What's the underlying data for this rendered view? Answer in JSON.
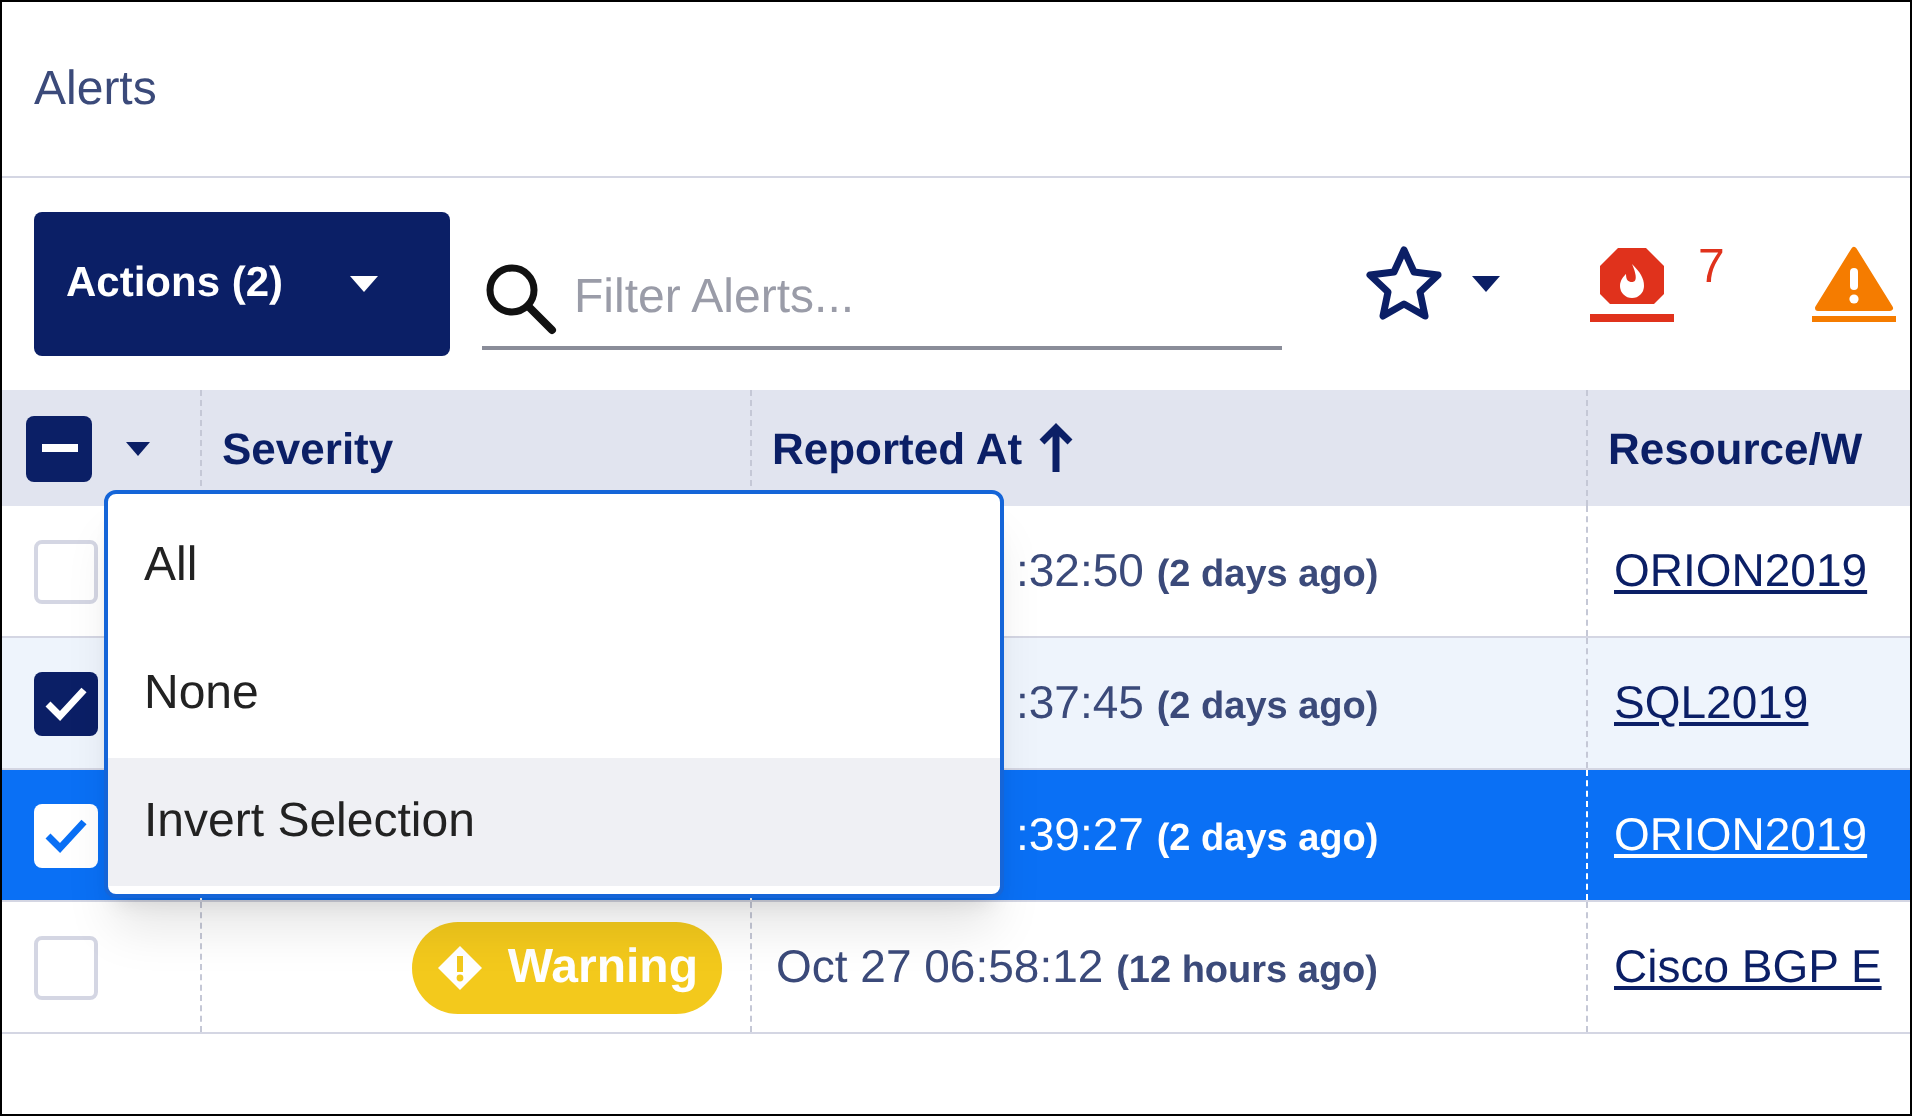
{
  "page": {
    "title": "Alerts"
  },
  "toolbar": {
    "actions_button": "Actions (2)",
    "filter": {
      "placeholder": "Filter Alerts..."
    },
    "counts": [
      {
        "kind": "critical",
        "value": "7"
      },
      {
        "kind": "warning"
      }
    ]
  },
  "table": {
    "select_all": {
      "indeterminate": true
    },
    "columns": [
      "Severity",
      "Reported At",
      "Resource/W"
    ],
    "rows": [
      {
        "checked": false,
        "selected": false,
        "reported_time": ":32:50",
        "reported_ago": "(2 days ago)",
        "resource": "ORION2019"
      },
      {
        "checked": true,
        "selected": false,
        "reported_time": ":37:45",
        "reported_ago": "(2 days ago)",
        "resource": "SQL2019"
      },
      {
        "checked": true,
        "selected": true,
        "reported_time": ":39:27",
        "reported_ago": "(2 days ago)",
        "resource": "ORION2019"
      },
      {
        "checked": false,
        "selected": false,
        "severity": "Warning",
        "reported_time": "Oct 27 06:58:12",
        "reported_ago": "(12 hours ago)",
        "resource": "Cisco BGP E"
      }
    ]
  },
  "selection_menu": {
    "items": [
      {
        "label": "All",
        "selected": false
      },
      {
        "label": "None",
        "selected": false
      },
      {
        "label": "Invert Selection",
        "selected": true
      }
    ]
  }
}
